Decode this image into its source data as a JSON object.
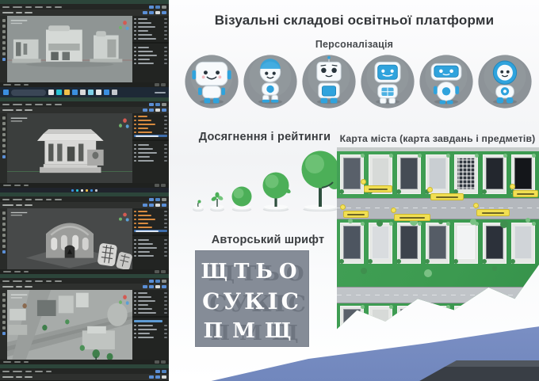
{
  "header": {
    "title": "Візуальні складові освітньої платформи"
  },
  "personalization": {
    "label": "Персоналізація",
    "robots": [
      {
        "name": "robot-square-head"
      },
      {
        "name": "robot-round-cap"
      },
      {
        "name": "robot-antenna-screen"
      },
      {
        "name": "robot-screen-face"
      },
      {
        "name": "robot-wide-head"
      },
      {
        "name": "robot-hooded"
      }
    ]
  },
  "achievements": {
    "label": "Досягнення і рейтинги",
    "stages": [
      "seed-sprout",
      "seedling",
      "bush",
      "young-tree",
      "mature-tree"
    ]
  },
  "city_map": {
    "label": "Карта міста (карта завдань і предметів)",
    "tag_count": 6
  },
  "author_font": {
    "label": "Авторський шрифт",
    "letter_rows": [
      "ЩТЬО",
      "СУКІС",
      "ПМЩ"
    ]
  },
  "workspace": {
    "app": "blender-3d-viewport",
    "screenshots": [
      {
        "name": "three-building-models"
      },
      {
        "name": "pavilion-model"
      },
      {
        "name": "church-model"
      },
      {
        "name": "city-scene"
      }
    ]
  },
  "colors": {
    "accent_blue": "#2fa3dd",
    "tree_green": "#4caf58",
    "map_green": "#3c9a50",
    "band_blue": "#7e91c6",
    "tag_yellow": "#f1df52",
    "font_panel_gray": "#858c97"
  }
}
